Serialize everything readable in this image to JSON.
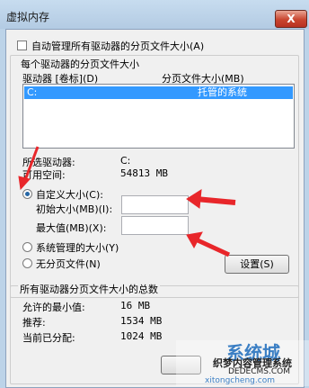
{
  "window": {
    "title": "虚拟内存",
    "close_label": "X"
  },
  "auto_manage": {
    "label": "自动管理所有驱动器的分页文件大小(A)",
    "checked": false
  },
  "paging_group": {
    "title": "每个驱动器的分页文件大小",
    "columns": [
      "驱动器 [卷标](D)",
      "分页文件大小(MB)"
    ],
    "rows": [
      {
        "drive": "C:",
        "size": "托管的系统"
      }
    ]
  },
  "selected_drive": {
    "label": "所选驱动器:",
    "value": "C:",
    "space_label": "可用空间:",
    "space_value": "54813 MB"
  },
  "options": {
    "custom": "自定义大小(C):",
    "initial_label": "初始大小(MB)(I):",
    "initial_value": "",
    "max_label": "最大值(MB)(X):",
    "max_value": "",
    "system": "系统管理的大小(Y)",
    "none": "无分页文件(N)",
    "selected": "custom",
    "set_button": "设置(S)"
  },
  "totals": {
    "title": "所有驱动器分页文件大小的总数",
    "rows": [
      {
        "label": "允许的最小值:",
        "value": "16 MB"
      },
      {
        "label": "推荐:",
        "value": "1534 MB"
      },
      {
        "label": "当前已分配:",
        "value": "1024 MB"
      }
    ]
  },
  "watermark": {
    "text1": "系统城",
    "text2": "织梦内容管理系统",
    "text3": "DEDECMS.COM",
    "text4": "xitongcheng.com"
  },
  "colors": {
    "accent": "#3399ff",
    "arrow": "#e8262a"
  }
}
